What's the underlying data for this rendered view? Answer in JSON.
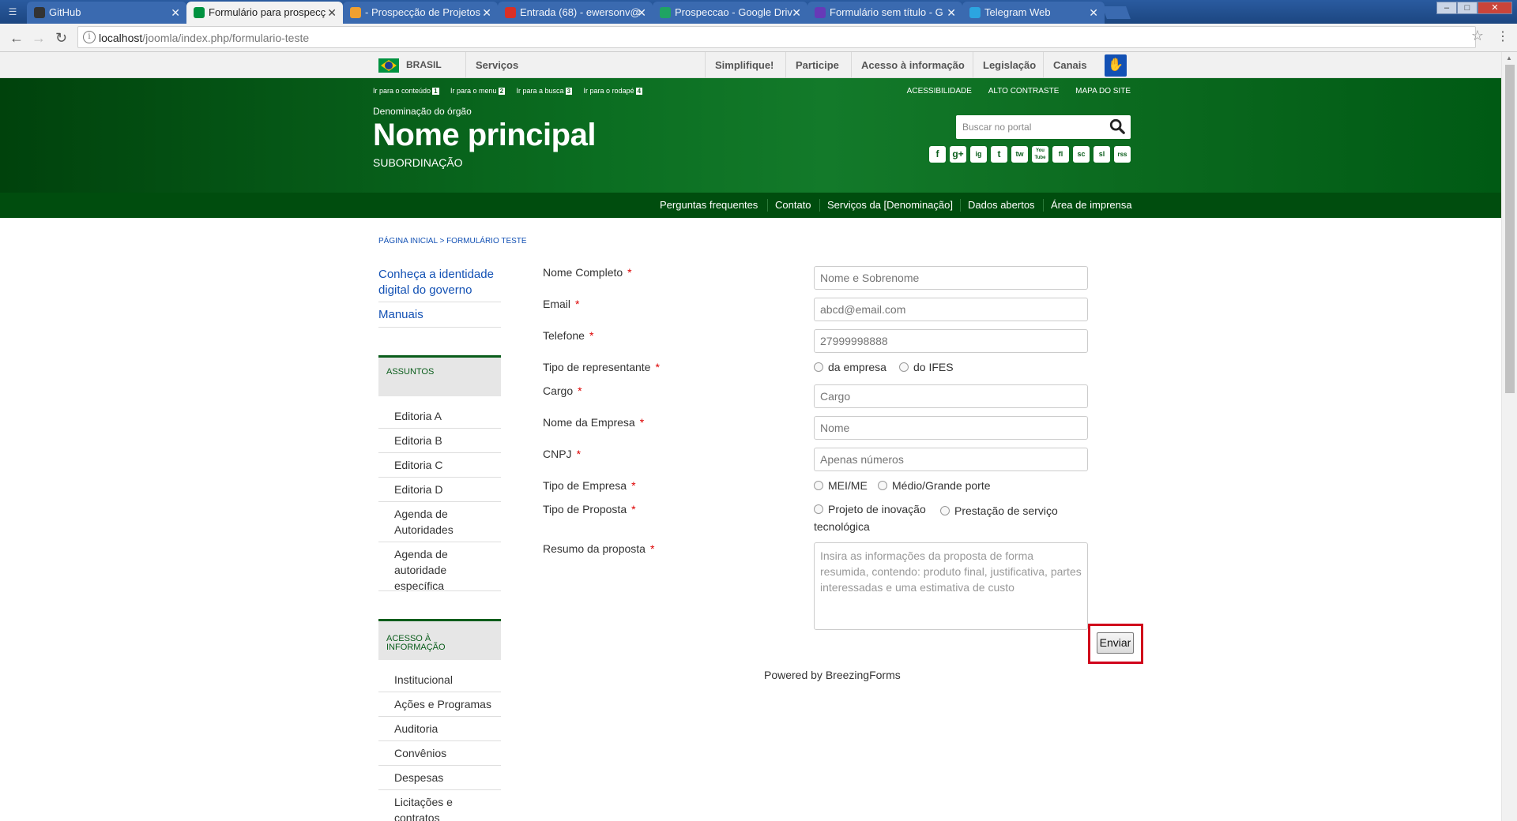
{
  "browser": {
    "tabs": [
      {
        "title": "GitHub",
        "active": false,
        "color": "#333333"
      },
      {
        "title": "Formulário para prospecç",
        "active": true,
        "color": "#00923f"
      },
      {
        "title": "- Prospecção de Projetos",
        "active": false,
        "color": "#f0a030"
      },
      {
        "title": "Entrada (68) - ewersonv@",
        "active": false,
        "color": "#d93025"
      },
      {
        "title": "Prospeccao - Google Driv",
        "active": false,
        "color": "#1fa463"
      },
      {
        "title": "Formulário sem título - G",
        "active": false,
        "color": "#673ab7"
      },
      {
        "title": "Telegram Web",
        "active": false,
        "color": "#2ca5e0"
      }
    ],
    "close_glyph": "✕",
    "url_host": "localhost",
    "url_path": "/joomla/index.php/formulario-teste"
  },
  "govbar": {
    "country": "BRASIL",
    "items": [
      "Serviços",
      "Simplifique!",
      "Participe",
      "Acesso à informação",
      "Legislação",
      "Canais"
    ]
  },
  "header": {
    "skip_links": [
      {
        "label": "Ir para o conteúdo",
        "key": "1"
      },
      {
        "label": "Ir para o menu",
        "key": "2"
      },
      {
        "label": "Ir para a busca",
        "key": "3"
      },
      {
        "label": "Ir para o rodapé",
        "key": "4"
      }
    ],
    "top_links": [
      "ACESSIBILIDADE",
      "ALTO CONTRASTE",
      "MAPA DO SITE"
    ],
    "org": "Denominação do órgão",
    "name": "Nome principal",
    "subordination": "SUBORDINAÇÃO",
    "search_placeholder": "Buscar no portal",
    "social": [
      "f",
      "g+",
      "ig",
      "t",
      "tw",
      "You Tube",
      "fl",
      "sc",
      "sl",
      "rss"
    ]
  },
  "menu": [
    "Perguntas frequentes",
    "Contato",
    "Serviços da [Denominação]",
    "Dados abertos",
    "Área de imprensa"
  ],
  "breadcrumb": {
    "home": "PÁGINA INICIAL",
    "sep": ">",
    "current": "FORMULÁRIO TESTE"
  },
  "sidebar": {
    "links": [
      "Conheça a identidade digital do governo",
      "Manuais"
    ],
    "sections": [
      {
        "title": "ASSUNTOS",
        "items": [
          "Editoria A",
          "Editoria B",
          "Editoria C",
          "Editoria D",
          "Agenda de Autoridades",
          "Agenda de autoridade específica"
        ]
      },
      {
        "title": "ACESSO À INFORMAÇÃO",
        "items": [
          "Institucional",
          "Ações e Programas",
          "Auditoria",
          "Convênios",
          "Despesas",
          "Licitações e contratos"
        ]
      }
    ]
  },
  "form": {
    "required_mark": "*",
    "fields": {
      "nome": {
        "label": "Nome Completo",
        "placeholder": "Nome e Sobrenome"
      },
      "email": {
        "label": "Email",
        "placeholder": "abcd@email.com"
      },
      "telefone": {
        "label": "Telefone",
        "placeholder": "27999998888"
      },
      "tipo_rep": {
        "label": "Tipo de representante",
        "options": [
          "da empresa",
          "do IFES"
        ]
      },
      "cargo": {
        "label": "Cargo",
        "placeholder": "Cargo"
      },
      "empresa": {
        "label": "Nome da Empresa",
        "placeholder": "Nome"
      },
      "cnpj": {
        "label": "CNPJ",
        "placeholder": "Apenas números"
      },
      "tipo_empresa": {
        "label": "Tipo de Empresa",
        "options": [
          "MEI/ME",
          "Médio/Grande porte"
        ]
      },
      "tipo_proposta": {
        "label": "Tipo de Proposta",
        "options": [
          "Projeto de inovação",
          "Prestação de serviço tecnológica"
        ]
      },
      "resumo": {
        "label": "Resumo da proposta",
        "placeholder": "Insira as informações da proposta de forma resumida, contendo: produto final, justificativa, partes interessadas e uma estimativa de custo"
      }
    },
    "submit": "Enviar"
  },
  "footer": {
    "powered": "Powered by BreezingForms"
  }
}
